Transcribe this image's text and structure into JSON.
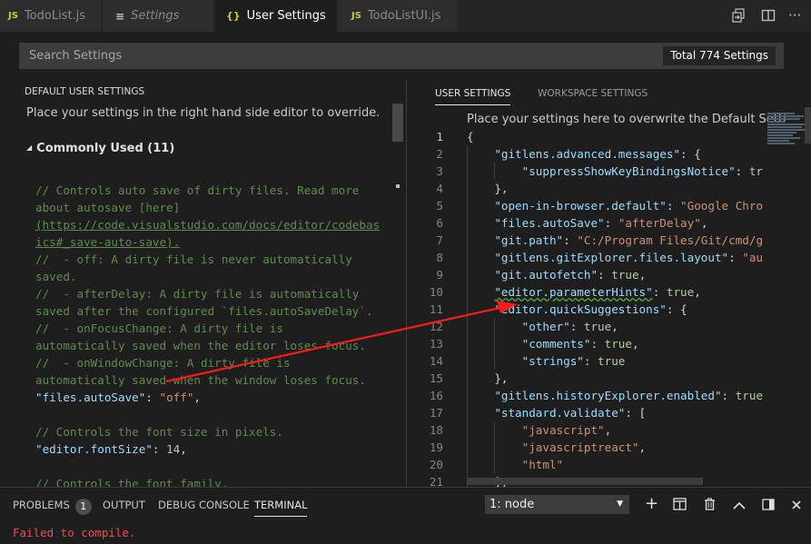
{
  "tabs": [
    {
      "icon": "JS",
      "label": "TodoList.js"
    },
    {
      "icon": "≡",
      "label": "Settings"
    },
    {
      "icon": "{}",
      "label": "User Settings",
      "close": "×"
    },
    {
      "icon": "JS",
      "label": "TodoListUI.js"
    }
  ],
  "search": {
    "placeholder": "Search Settings",
    "total": "Total 774 Settings"
  },
  "left": {
    "header": "DEFAULT USER SETTINGS",
    "description": "Place your settings in the right hand side editor to override.",
    "section": "Commonly Used (11)",
    "lines": [
      "// Controls auto save of dirty files. Read more",
      "about autosave [here]",
      "(https://code.visualstudio.com/docs/editor/codebas",
      "ics#_save-auto-save).",
      "//  - off: A dirty file is never automatically",
      "saved.",
      "//  - afterDelay: A dirty file is automatically",
      "saved after the configured `files.autoSaveDelay`.",
      "//  - onFocusChange: A dirty file is",
      "automatically saved when the editor loses focus.",
      "//  - onWindowChange: A dirty file is",
      "automatically saved when the window loses focus.",
      "",
      "",
      "// Controls the font size in pixels.",
      "",
      "",
      "// Controls the font family."
    ],
    "setting1_key": "\"files.autoSave\"",
    "setting1_val": "\"off\"",
    "setting2_key": "\"editor.fontSize\"",
    "setting2_val": "14"
  },
  "right": {
    "tabs": [
      "USER SETTINGS",
      "WORKSPACE SETTINGS"
    ],
    "description": "Place your settings here to overwrite the Default Setti",
    "lines": [
      {
        "n": "1",
        "t": "{"
      },
      {
        "n": "2",
        "k": "\"gitlens.advanced.messages\"",
        "p": ": {"
      },
      {
        "n": "3",
        "k": "\"suppressShowKeyBindingsNotice\"",
        "p": ": ",
        "v": "tr",
        "ind": 2
      },
      {
        "n": "4",
        "p": "},"
      },
      {
        "n": "5",
        "k": "\"open-in-browser.default\"",
        "p": ": ",
        "s": "\"Google Chro"
      },
      {
        "n": "6",
        "k": "\"files.autoSave\"",
        "p": ": ",
        "s": "\"afterDelay\"",
        "e": ","
      },
      {
        "n": "7",
        "k": "\"git.path\"",
        "p": ": ",
        "s": "\"C:/Program Files/Git/cmd/g"
      },
      {
        "n": "8",
        "k": "\"gitlens.gitExplorer.files.layout\"",
        "p": ": ",
        "s": "\"au"
      },
      {
        "n": "9",
        "k": "\"git.autofetch\"",
        "p": ": ",
        "v": "true",
        "e": ","
      },
      {
        "n": "10",
        "k": "\"editor.parameterHints\"",
        "p": ": ",
        "v": "true",
        "e": ",",
        "squig": true
      },
      {
        "n": "11",
        "k": "\"editor.quickSuggestions\"",
        "p": ": {"
      },
      {
        "n": "12",
        "k": "\"other\"",
        "p": ": ",
        "v": "true",
        "e": ",",
        "ind": 2
      },
      {
        "n": "13",
        "k": "\"comments\"",
        "p": ": ",
        "v": "true",
        "e": ",",
        "ind": 2
      },
      {
        "n": "14",
        "k": "\"strings\"",
        "p": ": ",
        "v": "true",
        "ind": 2
      },
      {
        "n": "15",
        "p": "},"
      },
      {
        "n": "16",
        "k": "\"gitlens.historyExplorer.enabled\"",
        "p": ": ",
        "v": "true"
      },
      {
        "n": "17",
        "k": "\"standard.validate\"",
        "p": ": ["
      },
      {
        "n": "18",
        "s": "\"javascript\"",
        "e": ",",
        "ind": 2
      },
      {
        "n": "19",
        "s": "\"javascriptreact\"",
        "e": ",",
        "ind": 2
      },
      {
        "n": "20",
        "s": "\"html\"",
        "ind": 2
      },
      {
        "n": "21",
        "p": "],"
      }
    ]
  },
  "panel": {
    "tabs": [
      "PROBLEMS",
      "OUTPUT",
      "DEBUG CONSOLE",
      "TERMINAL"
    ],
    "problems_count": "1",
    "terminal_select": "1: node",
    "error_text": "Failed to compile."
  },
  "colors": {
    "annotation_arrow": "#ff1a1a",
    "comment": "#608b4e",
    "key": "#9cdcfe",
    "string": "#ce9178",
    "number": "#b5cea8"
  }
}
